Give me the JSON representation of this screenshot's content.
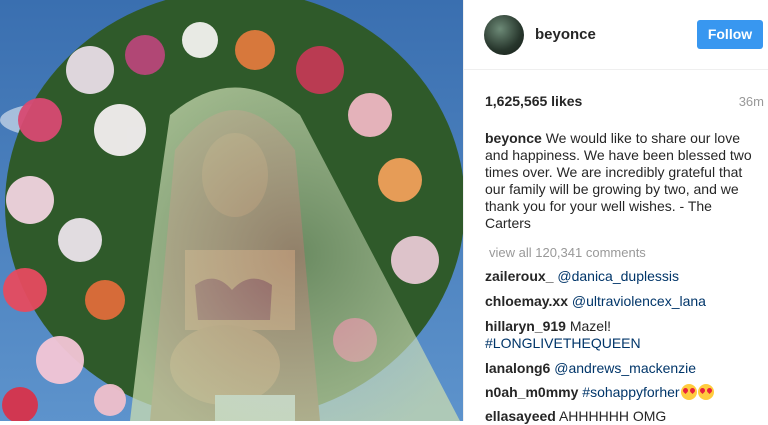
{
  "header": {
    "username": "beyonce",
    "follow_label": "Follow"
  },
  "post": {
    "likes": "1,625,565 likes",
    "time": "36m"
  },
  "caption": {
    "username": "beyonce",
    "text": "We would like to share our love and happiness. We have been blessed two times over. We are incredibly grateful that our family will be growing by two, and we thank you for your well wishes. - The Carters"
  },
  "view_all": "view all 120,341 comments",
  "comments": [
    {
      "user": "zaileroux_",
      "mention": "@danica_duplessis",
      "text": ""
    },
    {
      "user": "chloemay.xx",
      "mention": "@ultraviolencex_lana",
      "text": ""
    },
    {
      "user": "hillaryn_919",
      "text": "Mazel!",
      "text2": "#LONGLIVETHEQUEEN"
    },
    {
      "user": "lanalong6",
      "mention": "@andrews_mackenzie",
      "text": ""
    },
    {
      "user": "n0ah_m0mmy",
      "mention": "#sohappyforher",
      "emoji": "heart-eyes-emoji"
    },
    {
      "user": "ellasayeed",
      "text": "AHHHHHH OMG"
    }
  ],
  "colors": {
    "accent": "#3897f0",
    "link": "#003569",
    "muted": "#999999",
    "text": "#262626"
  }
}
